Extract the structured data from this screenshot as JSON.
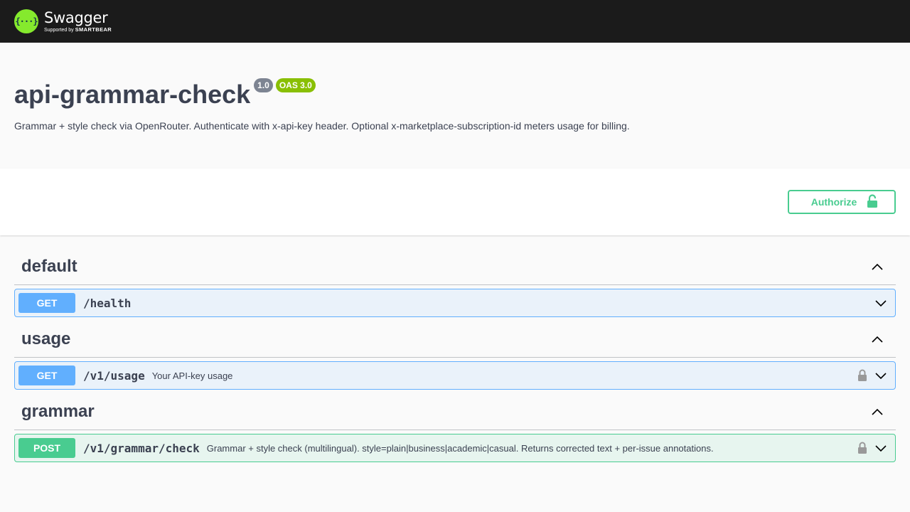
{
  "brand": {
    "name": "Swagger",
    "supported_by": "Supported by",
    "company": "SMARTBEAR",
    "mark": "{···}"
  },
  "info": {
    "title": "api-grammar-check",
    "version": "1.0",
    "oas": "OAS 3.0",
    "description": "Grammar + style check via OpenRouter. Authenticate with x-api-key header. Optional x-marketplace-subscription-id meters usage for billing."
  },
  "authorize": {
    "label": "Authorize"
  },
  "tags": [
    {
      "name": "default",
      "ops": [
        {
          "method": "GET",
          "path": "/health",
          "summary": ""
        }
      ]
    },
    {
      "name": "usage",
      "ops": [
        {
          "method": "GET",
          "path": "/v1/usage",
          "summary": "Your API-key usage"
        }
      ]
    },
    {
      "name": "grammar",
      "ops": [
        {
          "method": "POST",
          "path": "/v1/grammar/check",
          "summary": "Grammar + style check (multilingual). style=plain|business|academic|casual. Returns corrected text + per-issue annotations."
        }
      ]
    }
  ],
  "colors": {
    "topbar": "#1b1b1b",
    "logo_green": "#85ea2d",
    "get": "#61affe",
    "post": "#49cc90",
    "version_badge": "#7d8492",
    "oas_badge": "#89bf04"
  }
}
